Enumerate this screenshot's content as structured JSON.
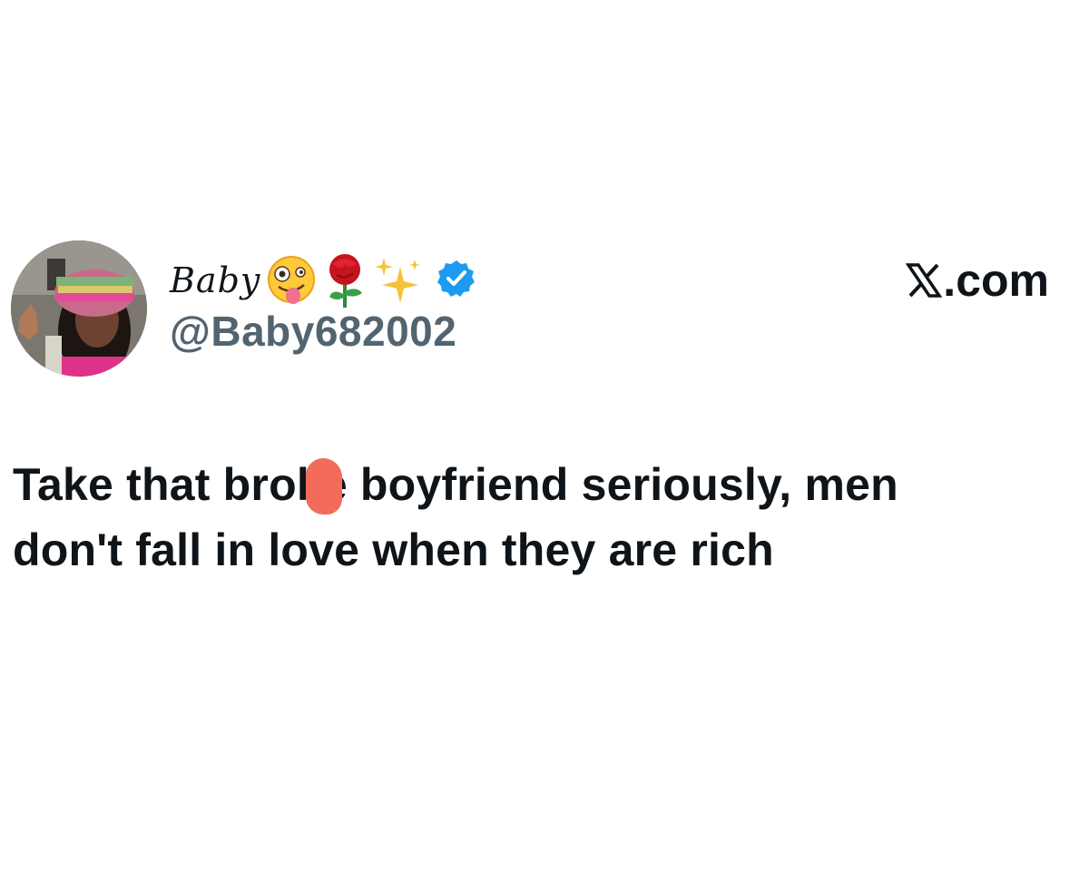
{
  "post": {
    "author": {
      "display_name": "Baby",
      "handle": "@Baby682002",
      "verified": true,
      "name_emojis": [
        "zany-face-emoji",
        "rose-emoji",
        "sparkles-emoji"
      ]
    },
    "source": {
      "logo_icon": "x-logo-icon",
      "domain": ".com"
    },
    "text": {
      "line1": "Take that broke boyfriend seriously, men",
      "line2": "don't fall in love when they are rich"
    }
  },
  "colors": {
    "text": "#0f1419",
    "handle": "#536471",
    "verified_blue": "#1d9bf0",
    "redaction": "#f26b5b",
    "background": "#ffffff"
  }
}
